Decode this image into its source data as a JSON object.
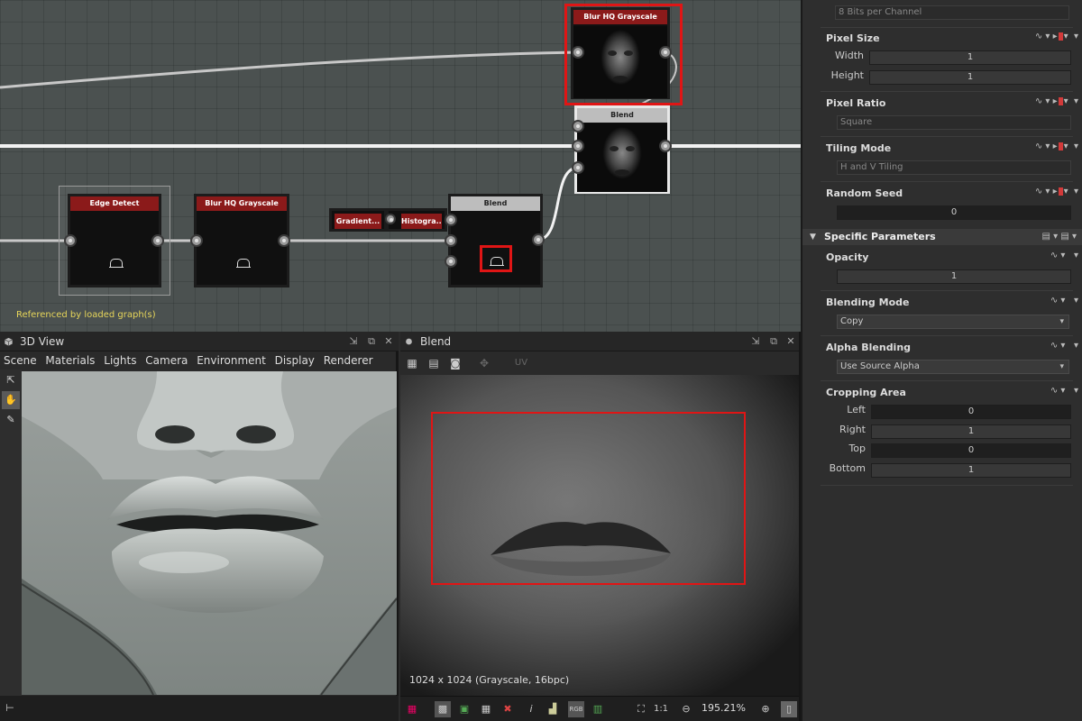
{
  "graph": {
    "referenced_note": "Referenced by loaded graph(s)",
    "nodes": {
      "blur_top": "Blur HQ Grayscale",
      "blend_top": "Blend",
      "edge_detect": "Edge Detect",
      "blur_bottom": "Blur HQ Grayscale",
      "gradient": "Gradient...",
      "histogram": "Histogra...",
      "blend_bottom": "Blend"
    }
  },
  "view3d": {
    "title": "3D View",
    "menu": [
      "Scene",
      "Materials",
      "Lights",
      "Camera",
      "Environment",
      "Display",
      "Renderer"
    ]
  },
  "view2d": {
    "title": "Blend",
    "uv_label": "UV",
    "resolution_info": "1024 x 1024 (Grayscale, 16bpc)",
    "ratio_label": "1:1",
    "zoom": "195.21%"
  },
  "properties": {
    "format_value": "8 Bits per Channel",
    "pixel_size": {
      "label": "Pixel Size",
      "width_label": "Width",
      "width": "1",
      "height_label": "Height",
      "height": "1"
    },
    "pixel_ratio": {
      "label": "Pixel Ratio",
      "value": "Square"
    },
    "tiling_mode": {
      "label": "Tiling Mode",
      "value": "H and V Tiling"
    },
    "random_seed": {
      "label": "Random Seed",
      "value": "0"
    },
    "specific_header": "Specific Parameters",
    "opacity": {
      "label": "Opacity",
      "value": "1"
    },
    "blending_mode": {
      "label": "Blending Mode",
      "value": "Copy"
    },
    "alpha_blending": {
      "label": "Alpha Blending",
      "value": "Use Source Alpha"
    },
    "cropping": {
      "label": "Cropping Area",
      "left_label": "Left",
      "left": "0",
      "right_label": "Right",
      "right": "1",
      "top_label": "Top",
      "top": "0",
      "bottom_label": "Bottom",
      "bottom": "1"
    }
  },
  "colors": {
    "highlight": "#e01515",
    "node_header_red": "#8b1a1a",
    "graph_bg": "#4b5150",
    "note_text": "#e6d55a"
  }
}
